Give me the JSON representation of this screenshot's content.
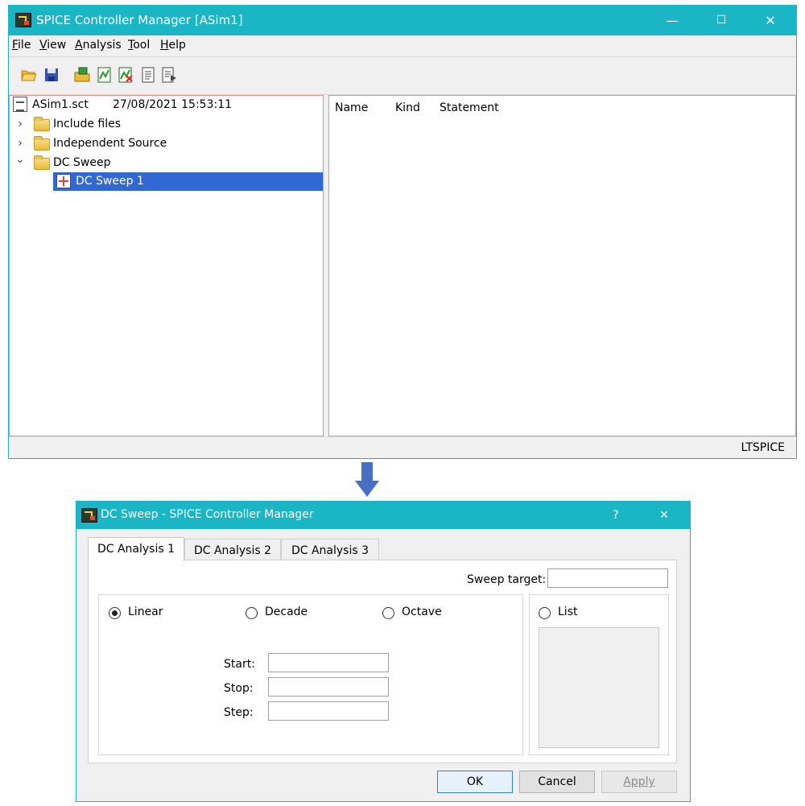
{
  "main": {
    "title": "SPICE Controller Manager [ASim1]",
    "controls": {
      "minimize": "—",
      "maximize": "☐",
      "close": "✕"
    },
    "menu": [
      {
        "key": "F",
        "rest": "ile"
      },
      {
        "key": "V",
        "rest": "iew"
      },
      {
        "key": "A",
        "rest": "nalysis"
      },
      {
        "key": "T",
        "rest": "ool"
      },
      {
        "key": "H",
        "rest": "elp"
      }
    ],
    "toolbar_icons": [
      "open-folder-icon",
      "save-icon",
      "open-project-icon",
      "analysis-add-icon",
      "analysis-delete-icon",
      "document-icon",
      "document-run-icon"
    ],
    "tree": {
      "root_file": "ASim1.sct",
      "root_timestamp": "27/08/2021 15:53:11",
      "items": [
        {
          "label": "Include files",
          "expanded": false
        },
        {
          "label": "Independent Source",
          "expanded": false
        },
        {
          "label": "DC Sweep",
          "expanded": true
        }
      ],
      "child": "DC Sweep 1",
      "expander_collapsed": "›",
      "expander_expanded": "⌄"
    },
    "columns": [
      "Name",
      "Kind",
      "Statement"
    ],
    "status": "LTSPICE",
    "colors": {
      "titlebar": "#1ab6c5",
      "selection": "#3268d2"
    }
  },
  "dialog": {
    "title": "DC Sweep - SPICE Controller Manager",
    "help": "?",
    "close": "✕",
    "tabs": [
      "DC Analysis 1",
      "DC Analysis 2",
      "DC Analysis 3"
    ],
    "sweep_target_label": "Sweep target:",
    "sweep_target_value": "",
    "modes": [
      {
        "label": "Linear",
        "checked": true
      },
      {
        "label": "Decade",
        "checked": false
      },
      {
        "label": "Octave",
        "checked": false
      },
      {
        "label": "List",
        "checked": false
      }
    ],
    "fields": [
      {
        "label": "Start:",
        "value": ""
      },
      {
        "label": "Stop:",
        "value": ""
      },
      {
        "label": "Step:",
        "value": ""
      }
    ],
    "buttons": {
      "ok": "OK",
      "cancel": "Cancel",
      "apply": "Apply"
    }
  }
}
